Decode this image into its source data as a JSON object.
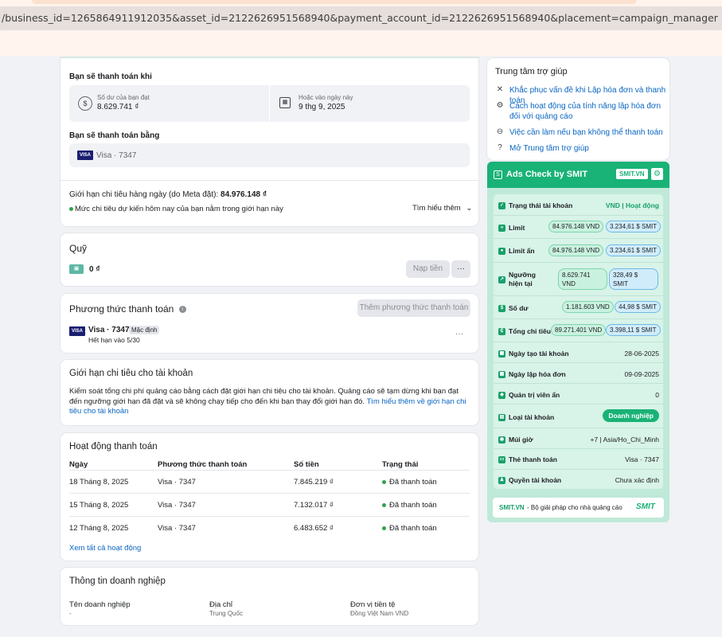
{
  "url": "/business_id=1265864911912035&asset_id=2122626951568940&payment_account_id=2122626951568940&placement=campaign_manager",
  "billing": {
    "pay_when_title": "Bạn sẽ thanh toán khi",
    "balance_label": "Số dư của bạn đạt",
    "balance_value": "8.629.741 ₫",
    "date_label": "Hoặc vào ngày này",
    "date_value": "9 thg 9, 2025",
    "pay_with_title": "Bạn sẽ thanh toán bằng",
    "card_text": "Visa · 7347",
    "daily_limit_label": "Giới hạn chi tiêu hàng ngày (do Meta đặt):",
    "daily_limit_value": "84.976.148 ₫",
    "daily_note": "Mức chi tiêu dự kiến hôm nay của bạn nằm trong giới hạn này",
    "learn_more": "Tìm hiểu thêm"
  },
  "fund": {
    "title": "Quỹ",
    "amount": "0 ₫",
    "topup_label": "Nạp tiền",
    "more": "···"
  },
  "payment_methods": {
    "title": "Phương thức thanh toán",
    "add_label": "Thêm phương thức thanh toán",
    "card_name": "Visa · 7347",
    "default_badge": "Mặc định",
    "expiry": "Hết hạn vào 5/30",
    "more": "···"
  },
  "spend_limit": {
    "title": "Giới hạn chi tiêu cho tài khoản",
    "desc": "Kiểm soát tổng chi phí quảng cáo bằng cách đặt giới hạn chi tiêu cho tài khoản. Quảng cáo sẽ tạm dừng khi bạn đạt đến ngưỡng giới hạn đã đặt và sẽ không chạy tiếp cho đến khi bạn thay đổi giới hạn đó.",
    "link": "Tìm hiểu thêm về giới hạn chi tiêu cho tài khoản"
  },
  "activity": {
    "title": "Hoạt động thanh toán",
    "headers": [
      "Ngày",
      "Phương thức thanh toán",
      "Số tiền",
      "Trạng thái"
    ],
    "rows": [
      {
        "date": "18 Tháng 8, 2025",
        "method": "Visa · 7347",
        "amount": "7.845.219 ₫",
        "status": "Đã thanh toán"
      },
      {
        "date": "15 Tháng 8, 2025",
        "method": "Visa · 7347",
        "amount": "7.132.017 ₫",
        "status": "Đã thanh toán"
      },
      {
        "date": "12 Tháng 8, 2025",
        "method": "Visa · 7347",
        "amount": "6.483.652 ₫",
        "status": "Đã thanh toán"
      }
    ],
    "see_all": "Xem tất cả hoạt động"
  },
  "business": {
    "title": "Thông tin doanh nghiệp",
    "name_label": "Tên doanh nghiệp",
    "name_value": "-",
    "address_label": "Địa chỉ",
    "address_value": "Trung Quốc",
    "currency_label": "Đơn vị tiền tệ",
    "currency_value": "Đồng Việt Nam VND"
  },
  "help": {
    "title": "Trung tâm trợ giúp",
    "items": [
      {
        "icon": "wrench-icon",
        "text": "Khắc phục vấn đề khi Lập hóa đơn và thanh toán"
      },
      {
        "icon": "gear-icon",
        "text": "Cách hoạt động của tính năng lập hóa đơn đối với quảng cáo"
      },
      {
        "icon": "minus-circle-icon",
        "text": "Việc cần làm nếu bạn không thể thanh toán"
      },
      {
        "icon": "question-icon",
        "text": "Mở Trung tâm trợ giúp"
      }
    ]
  },
  "smit": {
    "title": "Ads Check by SMIT",
    "badge": "SMIT.VN",
    "rows": [
      {
        "label": "Trạng thái tài khoản",
        "value": "VND | Hoạt động"
      },
      {
        "label": "Limit",
        "vnd": "84.976.148 VND",
        "smit": "3.234,61 $ SMIT"
      },
      {
        "label": "Limit ẩn",
        "vnd": "84.976.148 VND",
        "smit": "3.234,61 $ SMIT"
      },
      {
        "label": "Ngưỡng hiện tại",
        "vnd": "8.629.741 VND",
        "smit": "328,49 $ SMIT"
      },
      {
        "label": "Số dư",
        "vnd": "1.181.603 VND",
        "smit": "44,98 $ SMIT"
      },
      {
        "label": "Tổng chi tiêu",
        "vnd": "89.271.401 VND",
        "smit": "3.398,11 $ SMIT"
      },
      {
        "label": "Ngày tạo tài khoản",
        "value": "28-06-2025"
      },
      {
        "label": "Ngày lập hóa đơn",
        "value": "09-09-2025"
      },
      {
        "label": "Quản trị viên ẩn",
        "value": "0"
      },
      {
        "label": "Loại tài khoản",
        "value": "Doanh nghiệp"
      },
      {
        "label": "Múi giờ",
        "value": "+7 | Asia/Ho_Chi_Minh"
      },
      {
        "label": "Thẻ thanh toán",
        "value": "Visa · 7347"
      },
      {
        "label": "Quyền tài khoản",
        "value": "Chưa xác định"
      }
    ],
    "footer_brand": "SMIT.VN",
    "footer_text": " - Bộ giải pháp cho nhà quảng cáo",
    "footer_logo": "SMIT"
  },
  "colors": {
    "accent": "#19b277",
    "link": "#0a66c2",
    "status_green": "#31a24c"
  }
}
